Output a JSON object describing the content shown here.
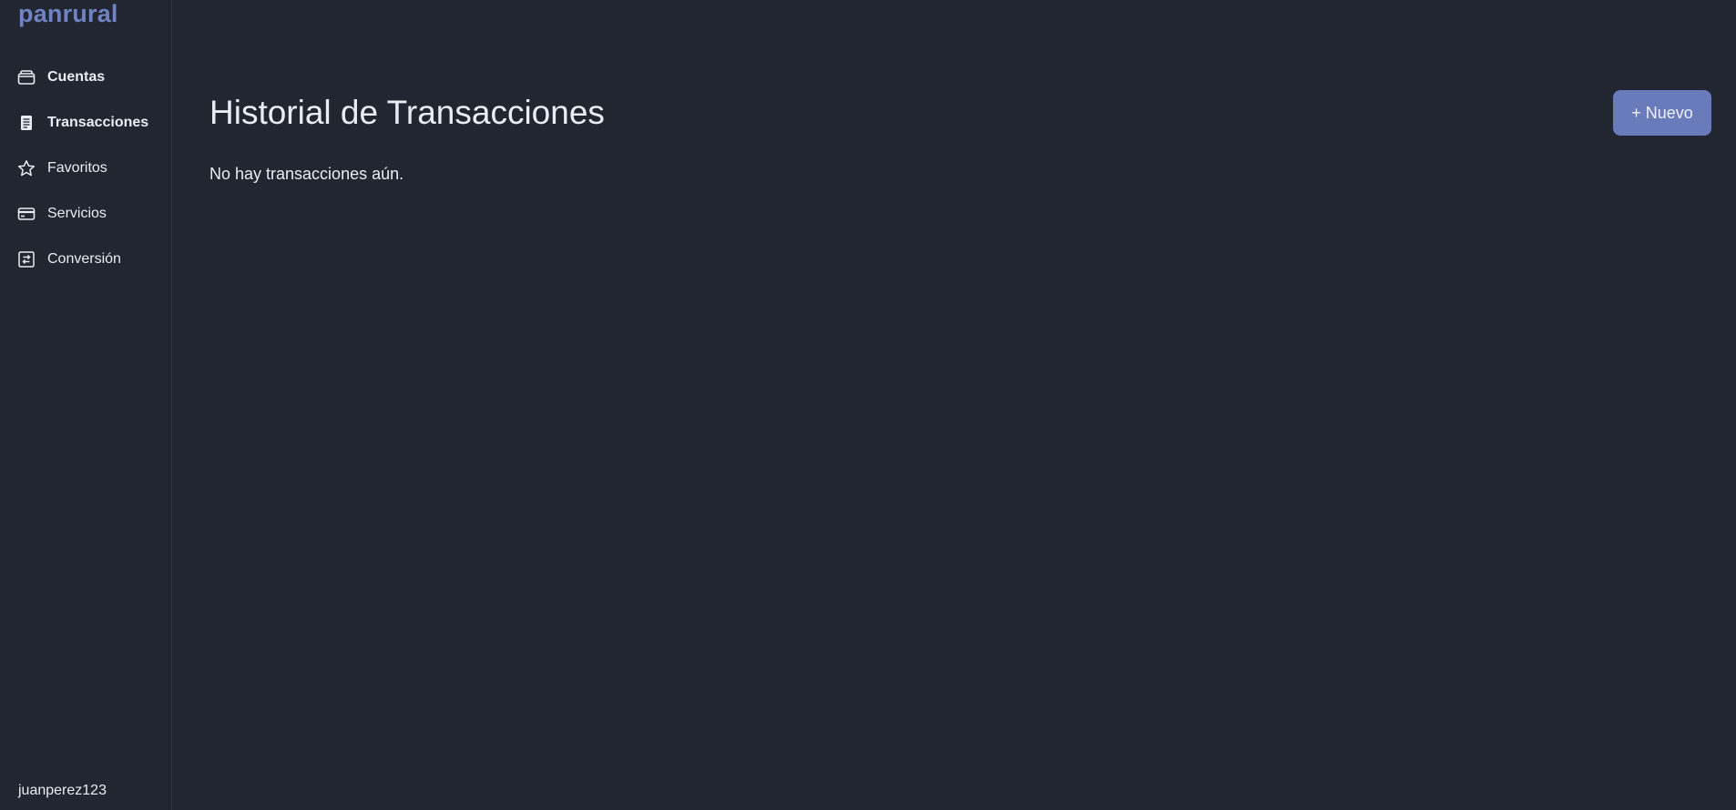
{
  "sidebar": {
    "brand": "panrural",
    "items": [
      {
        "label": "Cuentas",
        "icon": "wallet-icon",
        "bold": true
      },
      {
        "label": "Transacciones",
        "icon": "receipt-icon",
        "bold": true
      },
      {
        "label": "Favoritos",
        "icon": "star-icon",
        "bold": false
      },
      {
        "label": "Servicios",
        "icon": "credit-card-icon",
        "bold": false
      },
      {
        "label": "Conversión",
        "icon": "exchange-icon",
        "bold": false
      }
    ],
    "user": "juanperez123"
  },
  "main": {
    "title": "Historial de Transacciones",
    "new_button": "+ Nuevo",
    "empty_message": "No hay transacciones aún."
  },
  "colors": {
    "background": "#222630",
    "accent": "#6a7bbc",
    "brand": "#6f82c4",
    "text": "#e9ecf3"
  }
}
